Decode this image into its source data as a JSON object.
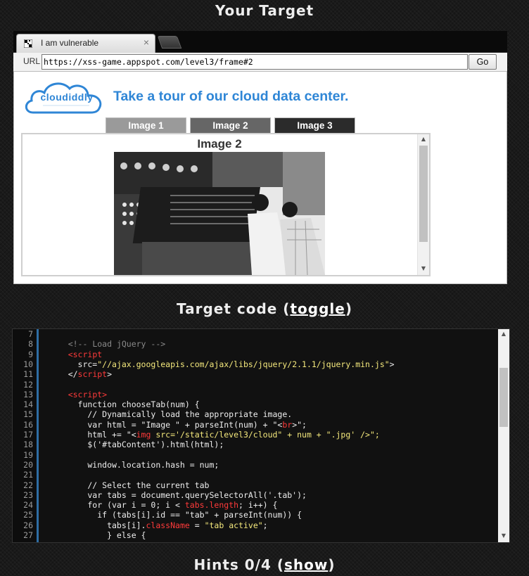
{
  "headings": {
    "target": "Your Target",
    "code_prefix": "Target code (",
    "code_link": "toggle",
    "code_suffix": ")",
    "hints_prefix": "Hints 0/4 (",
    "hints_link": "show",
    "hints_suffix": ")"
  },
  "browser": {
    "tab_title": "I am vulnerable",
    "tab_close": "×",
    "url_label": "URL",
    "url": "https://xss-game.appspot.com/level3/frame#2",
    "go_label": "Go"
  },
  "site": {
    "logo_text": "cloudiddly",
    "tagline": "Take a tour of our cloud data center.",
    "tabs": [
      {
        "label": "Image 1",
        "color": "#9a9a9a"
      },
      {
        "label": "Image 2",
        "color": "#666666"
      },
      {
        "label": "Image 3",
        "color": "#2b2b2b"
      }
    ],
    "content_title": "Image 2"
  },
  "code": {
    "line_numbers": [
      "7",
      "8",
      "9",
      "10",
      "11",
      "12",
      "13",
      "14",
      "15",
      "16",
      "17",
      "18",
      "19",
      "20",
      "21",
      "22",
      "23",
      "24",
      "25",
      "26",
      "27"
    ],
    "lines": [
      [],
      [
        {
          "t": "    "
        },
        {
          "t": "<!-- Load jQuery -->",
          "c": "c-comment"
        }
      ],
      [
        {
          "t": "    "
        },
        {
          "t": "<script",
          "c": "c-tag"
        }
      ],
      [
        {
          "t": "      src="
        },
        {
          "t": "\"//ajax.googleapis.com/ajax/libs/jquery/2.1.1/jquery.min.js\"",
          "c": "c-str"
        },
        {
          "t": ">"
        }
      ],
      [
        {
          "t": "    </"
        },
        {
          "t": "script",
          "c": "c-tag"
        },
        {
          "t": ">"
        }
      ],
      [],
      [
        {
          "t": "    "
        },
        {
          "t": "<script>",
          "c": "c-tag"
        }
      ],
      [
        {
          "t": "      function chooseTab(num) {"
        }
      ],
      [
        {
          "t": "        // Dynamically load the appropriate image."
        }
      ],
      [
        {
          "t": "        var html = \"Image \" + parseInt(num) + \"<"
        },
        {
          "t": "br",
          "c": "c-tag"
        },
        {
          "t": ">\";"
        }
      ],
      [
        {
          "t": "        html += \"<"
        },
        {
          "t": "img",
          "c": "c-tag"
        },
        {
          "t": " src='/static/level3/cloud\" + num + \".jpg' />\";",
          "c": "c-str"
        }
      ],
      [
        {
          "t": "        $('#tabContent').html(html);"
        }
      ],
      [],
      [
        {
          "t": "        window.location.hash = num;"
        }
      ],
      [],
      [
        {
          "t": "        // Select the current tab"
        }
      ],
      [
        {
          "t": "        var tabs = document.querySelectorAll('.tab');"
        }
      ],
      [
        {
          "t": "        for (var i = 0; i < "
        },
        {
          "t": "tabs.length",
          "c": "c-tag"
        },
        {
          "t": "; i++) {"
        }
      ],
      [
        {
          "t": "          if (tabs[i].id == \"tab\" + parseInt(num)) {"
        }
      ],
      [
        {
          "t": "            tabs[i]."
        },
        {
          "t": "className",
          "c": "c-tag"
        },
        {
          "t": " = "
        },
        {
          "t": "\"tab active\"",
          "c": "c-str"
        },
        {
          "t": ";"
        }
      ],
      [
        {
          "t": "            } else {"
        }
      ]
    ]
  }
}
